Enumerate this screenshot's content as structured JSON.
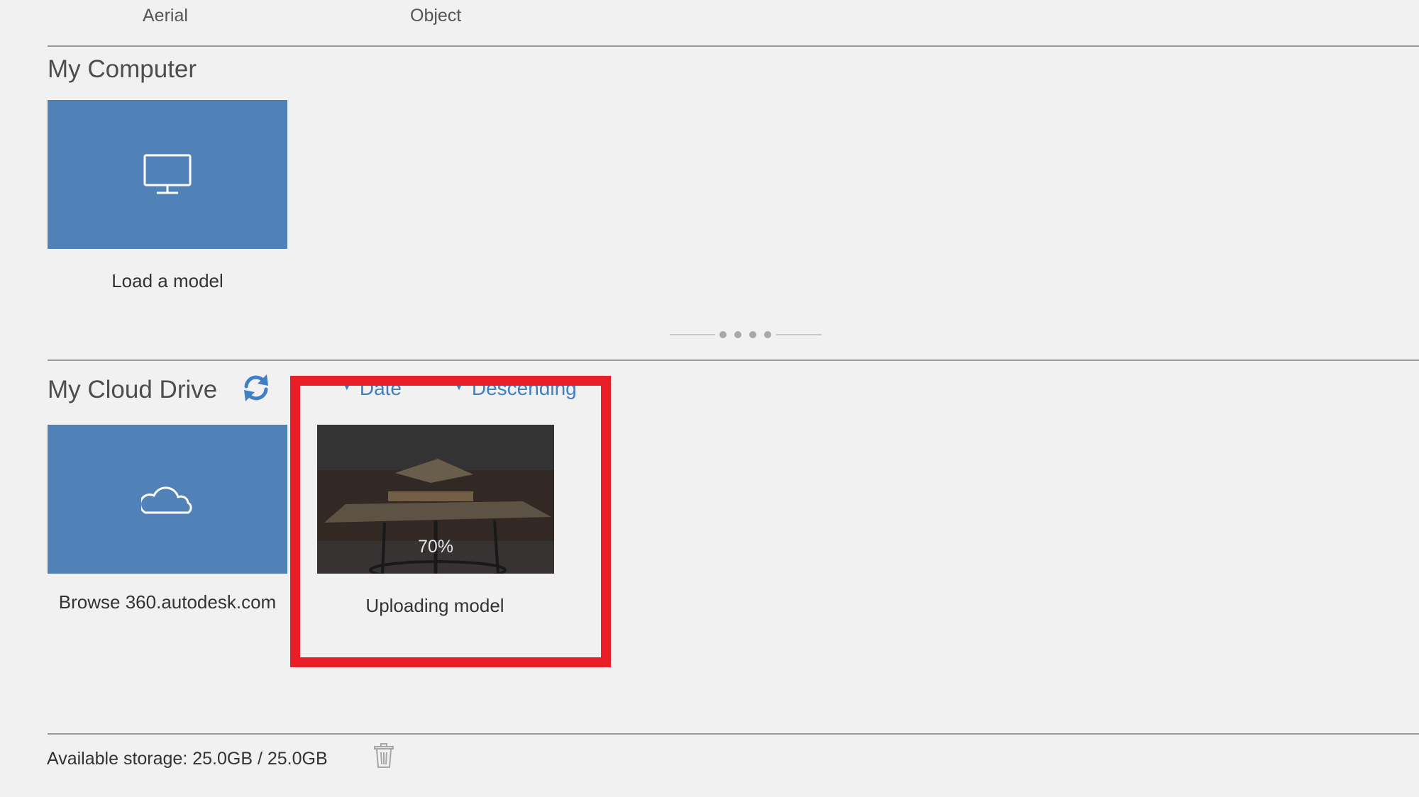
{
  "top_tabs": [
    "Aerial",
    "Object"
  ],
  "my_computer": {
    "title": "My Computer",
    "tile_label": "Load a model",
    "tile_icon": "monitor-icon"
  },
  "pager": {
    "dots": 4
  },
  "cloud_drive": {
    "title": "My Cloud Drive",
    "refresh_icon": "refresh-icon",
    "sort_field": "Date",
    "sort_order": "Descending",
    "browse_tile_label": "Browse 360.autodesk.com",
    "browse_tile_icon": "cloud-icon",
    "upload_item": {
      "progress_text": "70%",
      "progress": 0.7,
      "label": "Uploading model"
    }
  },
  "footer": {
    "storage_text": "Available storage: 25.0GB / 25.0GB",
    "trash_icon": "trash-icon"
  },
  "colors": {
    "background": "#f1f1f1",
    "tile_blue": "#5082b8",
    "link_blue": "#3f7fc4",
    "highlight_red": "#e81f28",
    "divider": "#9a9a9a"
  }
}
